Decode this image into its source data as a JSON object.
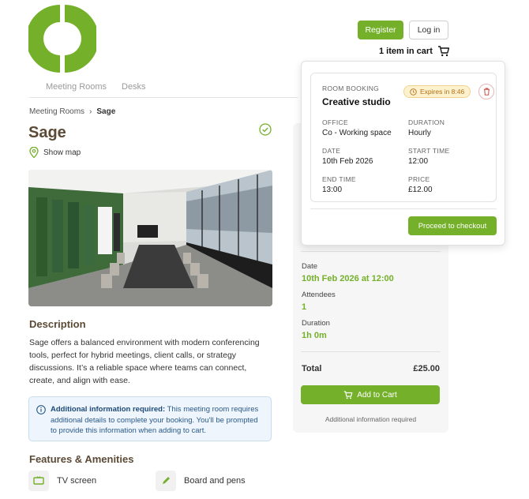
{
  "header": {
    "logo_icon": "brand-ring-logo",
    "register_label": "Register",
    "login_label": "Log in",
    "cart_label": "1 item in cart",
    "cart_icon": "cart-icon"
  },
  "nav": {
    "tabs": [
      {
        "label": "Meeting Rooms"
      },
      {
        "label": "Desks"
      }
    ]
  },
  "breadcrumb": {
    "parent": "Meeting Rooms",
    "separator": "›",
    "current": "Sage"
  },
  "room": {
    "name": "Sage",
    "show_map_label": "Show map",
    "description_heading": "Description",
    "description": "Sage offers a balanced environment with modern conferencing tools, perfect for hybrid meetings, client calls, or strategy discussions. It’s a reliable space where teams can connect, create, and align with ease.",
    "info_bold": "Additional information required:",
    "info_text": "This meeting room requires additional details to complete your booking. You'll be prompted to provide this information when adding to cart.",
    "features_heading": "Features & Amenities",
    "features": [
      {
        "label": "TV screen",
        "icon": "tv-icon"
      },
      {
        "label": "Board and pens",
        "icon": "pencil-icon"
      }
    ]
  },
  "summary": {
    "date_label": "Date",
    "date_value": "10th Feb 2026 at 12:00",
    "attendees_label": "Attendees",
    "attendees_value": "1",
    "duration_label": "Duration",
    "duration_value": "1h 0m",
    "total_label": "Total",
    "total_value": "£25.00",
    "add_to_cart_label": "Add to Cart",
    "note": "Additional information required"
  },
  "cart_popup": {
    "type_label": "ROOM BOOKING",
    "room_name": "Creative studio",
    "expires_label": "Expires in 8:46",
    "office_label": "OFFICE",
    "office_value": "Co - Working space",
    "duration_label": "DURATION",
    "duration_value": "Hourly",
    "date_label": "DATE",
    "date_value": "10th Feb 2026",
    "start_label": "START TIME",
    "start_value": "12:00",
    "end_label": "END TIME",
    "end_value": "13:00",
    "price_label": "PRICE",
    "price_value": "£12.00",
    "checkout_label": "Proceed to checkout"
  },
  "colors": {
    "brand_green": "#74b02a",
    "heading_brown": "#5b4a36",
    "info_blue": "#2a5a8a",
    "expires_amber": "#b76e12"
  }
}
